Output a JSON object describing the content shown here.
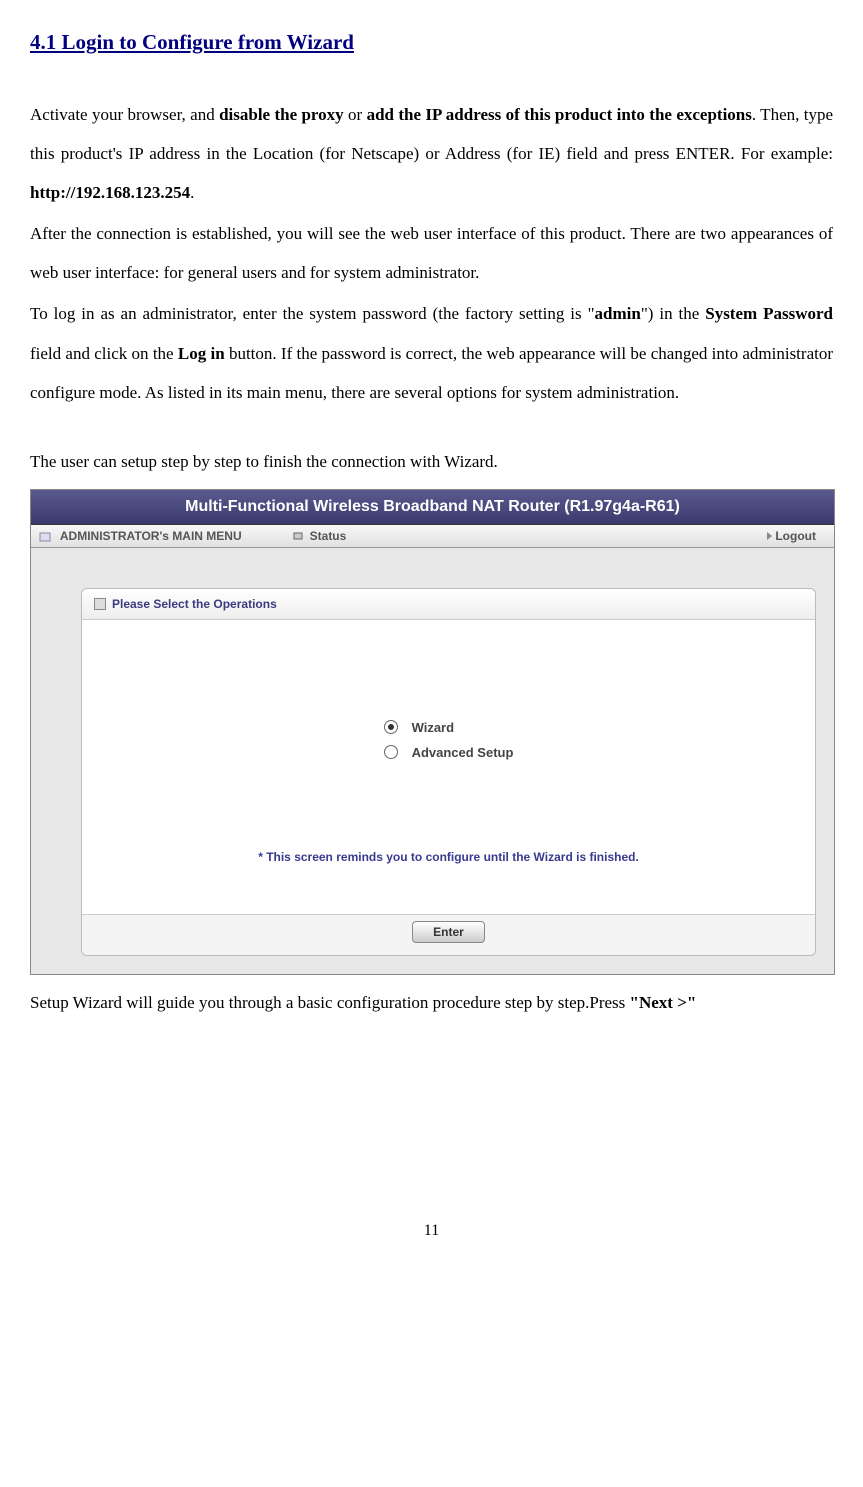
{
  "section_title": "4.1 Login to Configure from Wizard",
  "para1": {
    "t1": "Activate your browser, and ",
    "b1": "disable the proxy",
    "t2": " or ",
    "b2": "add the IP address of this product into the exceptions",
    "t3": ". Then, type this product's IP address in the Location (for Netscape) or Address (for IE) field and press ENTER. For example: ",
    "b3": "http://192.168.123.254",
    "t4": "."
  },
  "para2": "After the connection is established, you will see the web user interface of this product. There are two appearances of web user interface: for general users and for system administrator.",
  "para3": {
    "t1": "To log in as an administrator, enter the system password (the factory setting is  \"",
    "b1": "admin",
    "t2": "\") in the ",
    "b2": "System Password",
    "t3": " field and click on the ",
    "b3": "Log in",
    "t4": " button. If the password is correct, the web appearance will be changed into administrator configure mode. As listed in its main menu, there are several options for system administration."
  },
  "para4": "The user can setup step by step to finish the connection with Wizard.",
  "screenshot": {
    "header_title": "Multi-Functional Wireless Broadband NAT Router (R1.97g4a-R61)",
    "menu_main": "ADMINISTRATOR's MAIN MENU",
    "menu_status": "Status",
    "menu_logout": "Logout",
    "panel_title": "Please Select the Operations",
    "option_wizard": "Wizard",
    "option_advanced": "Advanced Setup",
    "footer_note": "* This screen reminds you to configure until the Wizard is finished.",
    "enter_button": "Enter"
  },
  "para5": {
    "t1": "Setup Wizard will guide you through a basic configuration procedure step by step.Press    ",
    "b1": "\"Next >\""
  },
  "page_number": "11"
}
